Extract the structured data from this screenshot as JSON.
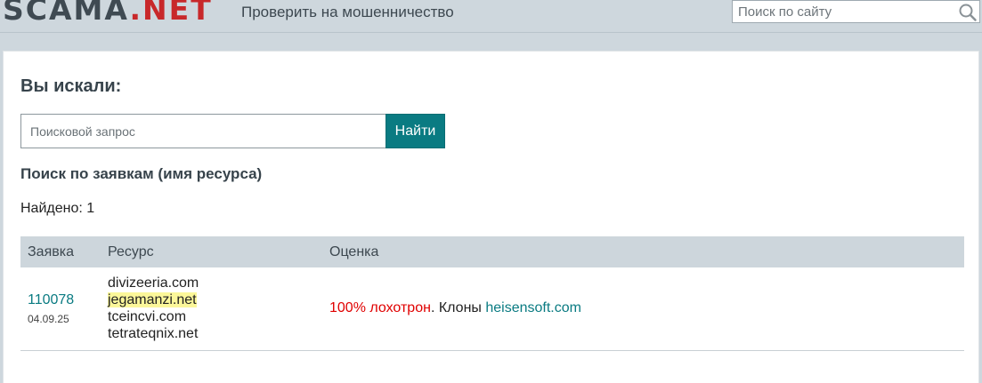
{
  "header": {
    "logo": {
      "part1": "SCAMA",
      "part2": ".NET"
    },
    "nav_link": "Проверить на мошенничество",
    "site_search_placeholder": "Поиск по сайту",
    "search_icon": "magnifier-icon"
  },
  "main": {
    "title": "Вы искали:",
    "query_placeholder": "Поисковой запрос",
    "find_button": "Найти",
    "section_heading": "Поиск по заявкам (имя ресурса)",
    "found_label": "Найдено: 1",
    "table": {
      "columns": [
        "Заявка",
        "Ресурс",
        "Оценка"
      ],
      "rows": [
        {
          "claim_id": "110078",
          "claim_date": "04.09.25",
          "resources": [
            "divizeeria.com",
            "jegamanzi.net",
            "tceincvi.com",
            "tetrateqnix.net"
          ],
          "highlighted_resource_index": 1,
          "score_bad": "100% лохотрон",
          "score_text": ". Клоны ",
          "clone_link": "heisensoft.com"
        }
      ]
    }
  },
  "colors": {
    "accent": "#0a7b82",
    "logo_red": "#c8282a",
    "danger": "#e00000",
    "highlight": "#fbf79a",
    "header_bg": "#ced7dd"
  }
}
